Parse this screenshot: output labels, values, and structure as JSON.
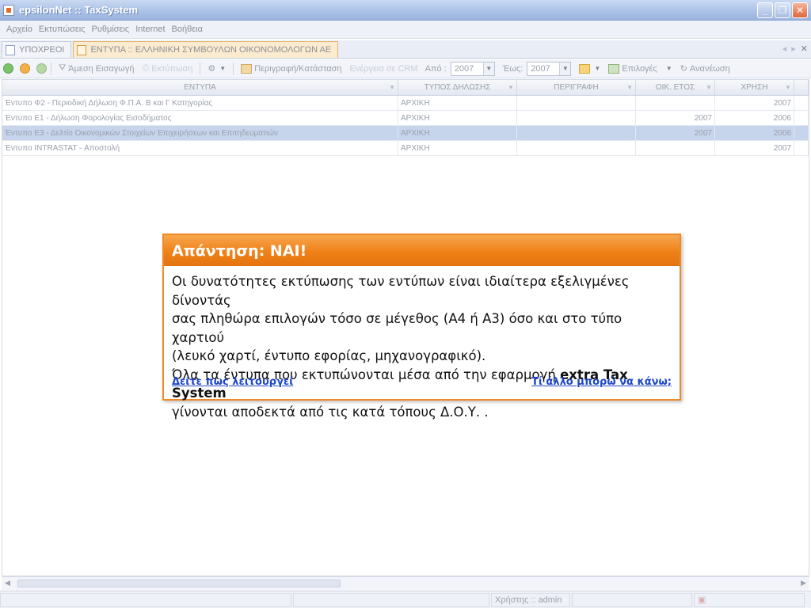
{
  "window": {
    "title": "epsilonNet :: TaxSystem"
  },
  "menu": {
    "items": [
      "Αρχείο",
      "Εκτυπώσεις",
      "Ρυθμίσεις",
      "Internet",
      "Βοήθεια"
    ]
  },
  "tabs": [
    {
      "label": "ΥΠΟΧΡΕΟΙ",
      "active": false
    },
    {
      "label": "ΕΝΤΥΠΑ :: ΕΛΛΗΝΙΚΗ ΣΥΜΒΟΥΛΩΝ ΟΙΚΟΝΟΜΟΛΟΓΩΝ ΑΕ",
      "active": true
    }
  ],
  "toolbar": {
    "direct_entry": "Άμεση Εισαγωγή",
    "print": "Εκτύπωση",
    "description_status": "Περιγραφή/Κατάσταση",
    "crm_activity": "Ενέργεια σε CRM",
    "from_label": "Από :",
    "from_value": "2007",
    "to_label": "Έως:",
    "to_value": "2007",
    "options": "Επιλογές",
    "refresh": "Ανανέωση"
  },
  "grid": {
    "columns": [
      "ΕΝΤΥΠΑ",
      "ΤΥΠΟΣ ΔΗΛΩΣΗΣ",
      "ΠΕΡΙΓΡΑΦΗ",
      "ΟΙΚ. ΕΤΟΣ",
      "ΧΡΗΣΗ"
    ],
    "rows": [
      {
        "form": "Έντυπο Φ2 - Περιοδική Δήλωση Φ.Π.Α. Β και Γ Κατηγορίας",
        "type": "ΑΡΧΙΚΗ",
        "description": "",
        "fiscal_year": "",
        "use": "2007",
        "selected": false
      },
      {
        "form": "Έντυπο Ε1 - Δήλωση Φορολογίας Εισοδήματος",
        "type": "ΑΡΧΙΚΗ",
        "description": "",
        "fiscal_year": "2007",
        "use": "2006",
        "selected": false
      },
      {
        "form": "Έντυπο Ε3 - Δελτίο Οικονομικών Στοιχείων Επιχειρήσεων και Επιτηδευματιών",
        "type": "ΑΡΧΙΚΗ",
        "description": "",
        "fiscal_year": "2007",
        "use": "2006",
        "selected": true
      },
      {
        "form": "Έντυπο INTRASTAT - Αποστολή",
        "type": "ΑΡΧΙΚΗ",
        "description": "",
        "fiscal_year": "",
        "use": "2007",
        "selected": false
      }
    ]
  },
  "statusbar": {
    "user": "Χρήστης :: admin"
  },
  "callout": {
    "title": "Απάντηση: ΝΑΙ!",
    "line1": "Οι δυνατότητες εκτύπωσης των εντύπων είναι ιδιαίτερα εξελιγμένες δίνοντάς",
    "line2": "σας πληθώρα επιλογών τόσο σε μέγεθος (Α4 ή Α3) όσο και στο τύπο χαρτιού",
    "line3": "(λευκό χαρτί, έντυπο εφορίας, μηχανογραφικό).",
    "line4_pre": "Όλα τα έντυπα που εκτυπώνονται μέσα από την εφαρμογή ",
    "line4_bold": "extra Tax System",
    "line5": "γίνονται αποδεκτά από τις κατά τόπους Δ.Ο.Υ. .",
    "link_left": "Δείτε πως λειτουργεί",
    "link_right": "Τί άλλο μπορώ να κάνω;"
  },
  "colors": {
    "accent": "#ef8117",
    "link": "#1d47c8",
    "selected_row": "#c6d4ec"
  }
}
